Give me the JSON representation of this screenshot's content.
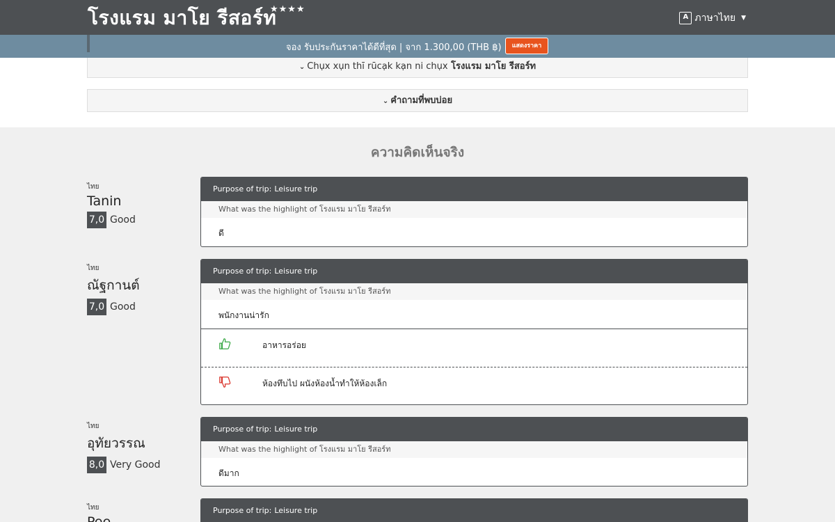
{
  "header": {
    "hotel_name": "โรงแรม มาโย รีสอร์ท",
    "stars": "★★★★",
    "language": "ภาษาไทย"
  },
  "booking": {
    "text": "จอง รับประกันราคาได้ดีที่สุด | จาก 1.300,00 (THB ฿)",
    "button": "แสดงราคา"
  },
  "sections": {
    "collapse_1_prefix": "Chụx xụn thī rūcạk kạn ni chụx",
    "collapse_1_bold": "โรงแรม มาโย รีสอร์ท",
    "collapse_2": "คำถามที่พบบ่อย",
    "reviews_title": "ความคิดเห็นจริง"
  },
  "labels": {
    "purpose": "Purpose of trip:",
    "highlight_q": "What was the highlight of โรงแรม มาโย รีสอร์ท"
  },
  "reviews": [
    {
      "country": "ไทย",
      "name": "Tanin",
      "score": "7,0",
      "verdict": "Good",
      "trip": "Leisure trip",
      "answer": "ดี"
    },
    {
      "country": "ไทย",
      "name": "ณัฐกานต์",
      "score": "7,0",
      "verdict": "Good",
      "trip": "Leisure trip",
      "answer": "พนักงานน่ารัก",
      "liked": "อาหารอร่อย",
      "disliked": "ห้องทึบไป ผนังห้องน้ำทำให้ห้องเล็ก"
    },
    {
      "country": "ไทย",
      "name": "อุทัยวรรณ",
      "score": "8,0",
      "verdict": "Very Good",
      "trip": "Leisure trip",
      "answer": "ดีมาก"
    },
    {
      "country": "ไทย",
      "name": "Pee",
      "trip": "Leisure trip"
    }
  ],
  "colors": {
    "header": "#4d5053",
    "booking_bar": "#6e8ca0",
    "cta": "#e8541e",
    "thumb_up": "#3aa845",
    "thumb_down": "#d9342b"
  }
}
